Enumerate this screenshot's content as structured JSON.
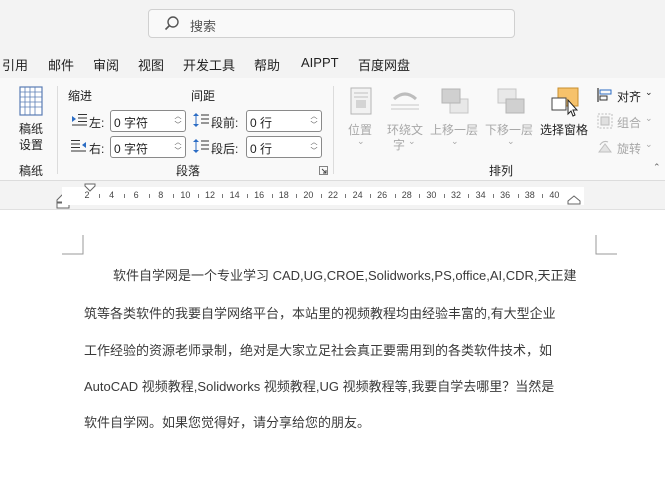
{
  "search": {
    "placeholder": "搜索"
  },
  "tabs": [
    "引用",
    "邮件",
    "审阅",
    "视图",
    "开发工具",
    "帮助",
    "AIPPT",
    "百度网盘"
  ],
  "ribbon": {
    "manuscript": {
      "button_line1": "稿纸",
      "button_line2": "设置",
      "group_label": "稿纸"
    },
    "paragraph": {
      "indent_header": "缩进",
      "spacing_header": "间距",
      "left_label": "左:",
      "left_value": "0 字符",
      "right_label": "右:",
      "right_value": "0 字符",
      "before_label": "段前:",
      "before_value": "0 行",
      "after_label": "段后:",
      "after_value": "0 行",
      "group_label": "段落"
    },
    "arrange": {
      "position": "位置",
      "wrap_line1": "环绕文",
      "wrap_line2": "字",
      "bring_forward": "上移一层",
      "send_backward": "下移一层",
      "selection_pane": "选择窗格",
      "align": "对齐",
      "group": "组合",
      "rotate": "旋转",
      "group_label": "排列"
    }
  },
  "ruler": {
    "numbers": [
      "2",
      "4",
      "6",
      "8",
      "10",
      "12",
      "14",
      "16",
      "18",
      "20",
      "22",
      "24",
      "26",
      "28",
      "30",
      "32",
      "34",
      "36",
      "38",
      "40"
    ]
  },
  "document": {
    "lines": [
      "软件自学网是一个专业学习 CAD,UG,CROE,Solidworks,PS,office,AI,CDR,天正建",
      "筑等各类软件的我要自学网络平台，本站里的视频教程均由经验丰富的,有大型企业",
      "工作经验的资源老师录制，绝对是大家立足社会真正要需用到的各类软件技术，如",
      "AutoCAD 视频教程,Solidworks 视频教程,UG 视频教程等,我要自学去哪里？当然是",
      "软件自学网。如果您觉得好，请分享给您的朋友。"
    ]
  },
  "colors": {
    "titlebar_bg": "#f3f3f3",
    "ribbon_bg": "#f9f9f9",
    "selection_pane_accent": "#f6c26b",
    "indent_icon_blue": "#2b6cc4"
  }
}
